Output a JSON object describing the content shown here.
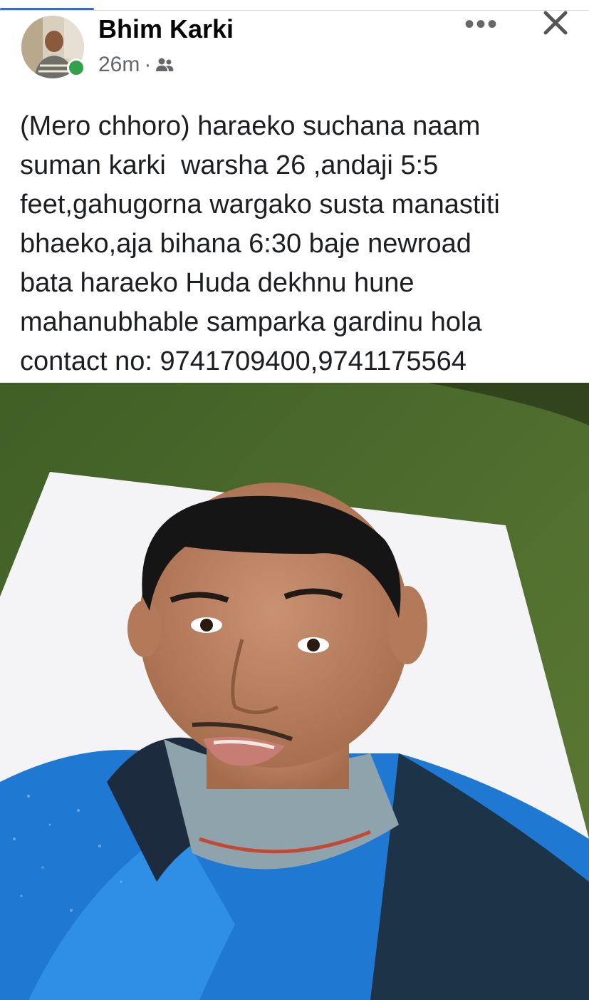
{
  "post": {
    "author": "Bhim Karki",
    "time": "26m",
    "separator": "·",
    "audience_icon": "friends-icon",
    "more_label": "•••",
    "text": "(Mero chhoro) haraeko suchana naam\nsuman karki  warsha 26 ,andaji 5:5\nfeet,gahugorna wargako susta manastiti\nbhaeko,aja bihana 6:30 baje newroad\nbata haraeko Huda dekhnu hune\nmahanubhable samparka gardinu hola\ncontact no: 9741709400,9741175564"
  },
  "colors": {
    "accent": "#2f6fd6",
    "online": "#31a24c",
    "meta_text": "#65676b",
    "carpet": "#4a6a2c",
    "jacket_blue": "#1f78d1"
  }
}
